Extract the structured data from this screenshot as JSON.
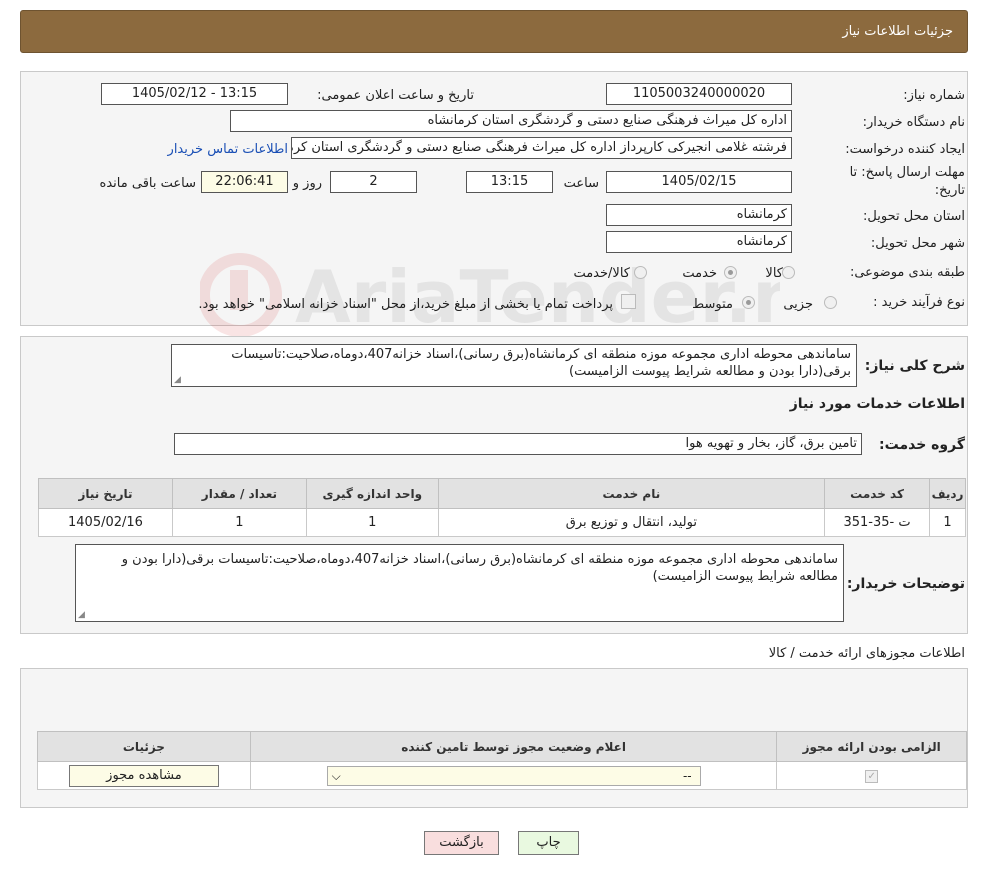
{
  "header": {
    "title": "جزئیات اطلاعات نیاز"
  },
  "details": {
    "need_number_label": "شماره نیاز:",
    "need_number": "1105003240000020",
    "announce_label": "تاریخ و ساعت اعلان عمومی:",
    "announce_value": "1405/02/12 - 13:15",
    "buyer_org_label": "نام دستگاه خریدار:",
    "buyer_org": "اداره کل میراث فرهنگی  صنایع دستی و گردشگری استان کرمانشاه",
    "requester_label": "ایجاد کننده درخواست:",
    "requester": "فرشته غلامی انجیرکی کارپرداز اداره کل میراث فرهنگی  صنایع دستی و گردشگری استان کرمانشاه",
    "contact_link": "اطلاعات تماس خریدار",
    "deadline_label": "مهلت ارسال پاسخ: تا تاریخ:",
    "deadline_date": "1405/02/15",
    "time_label": "ساعت",
    "deadline_time": "13:15",
    "days_value": "2",
    "days_label": "روز و",
    "remaining_time": "22:06:41",
    "remaining_label": "ساعت باقی مانده",
    "province_label": "استان محل تحویل:",
    "province": "کرمانشاه",
    "city_label": "شهر محل تحویل:",
    "city": "کرمانشاه",
    "category_label": "طبقه بندی موضوعی:",
    "category_options": [
      "کالا",
      "خدمت",
      "کالا/خدمت"
    ],
    "category_selected": "خدمت",
    "process_label": "نوع فرآیند خرید :",
    "process_options": [
      "جزیی",
      "متوسط"
    ],
    "payment_note": "پرداخت تمام یا بخشی از مبلغ خرید،از محل \"اسناد خزانه اسلامی\" خواهد بود."
  },
  "summary": {
    "label": "شرح کلی نیاز:",
    "text": "ساماندهی محوطه اداری مجموعه موزه منطقه ای کرمانشاه(برق رسانی)،اسناد خزانه407،دوماه،صلاحیت:تاسیسات برقی(دارا بودن و مطالعه شرایط پیوست الزامیست)"
  },
  "services": {
    "section_title": "اطلاعات خدمات مورد نیاز",
    "group_label": "گروه خدمت:",
    "group_value": "تامین برق، گاز، بخار و تهویه هوا",
    "columns": [
      "ردیف",
      "کد خدمت",
      "نام خدمت",
      "واحد اندازه گیری",
      "تعداد / مقدار",
      "تاریخ نیاز"
    ],
    "rows": [
      {
        "row": "1",
        "code": "ت -35-351",
        "name": "تولید، انتقال و توزیع برق",
        "unit": "1",
        "qty": "1",
        "date": "1405/02/16"
      }
    ]
  },
  "buyer_notes": {
    "label": "توضیحات خریدار:",
    "text": "ساماندهی محوطه اداری مجموعه موزه منطقه ای کرمانشاه(برق رسانی)،اسناد خزانه407،دوماه،صلاحیت:تاسیسات برقی(دارا بودن و مطالعه شرایط پیوست الزامیست)"
  },
  "permits": {
    "section_title": "اطلاعات مجوزهای ارائه خدمت / کالا",
    "columns": [
      "الزامی بودن ارائه مجوز",
      "اعلام وضعیت مجوز توسط تامین کننده",
      "جزئیات"
    ],
    "select_value": "--",
    "view_button": "مشاهده مجوز"
  },
  "footer": {
    "print_button": "چاپ",
    "back_button": "بازگشت"
  },
  "colors": {
    "header_bg": "#8c6a3e",
    "link": "#1a4fb5",
    "back_button_bg": "#f9dede",
    "print_button_bg": "#e9f9e0"
  },
  "watermark": {
    "text": "AriaTender.neT"
  }
}
